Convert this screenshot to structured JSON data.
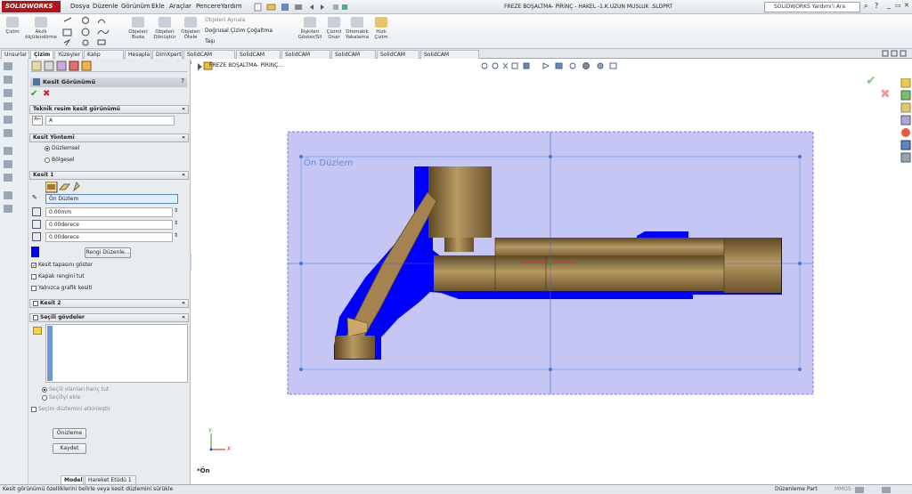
{
  "app": {
    "logo": "SOLIDWORKS",
    "document_title": "FREZE BOŞALTMA- PİRİNÇ - HAKEL -1.K.UZUN MUSLUK .SLDPRT",
    "help_search_placeholder": "SOLIDWORKS Yardımı'i Ara"
  },
  "menu": [
    "Dosya",
    "Düzenle",
    "Görünüm",
    "Ekle",
    "Araçlar",
    "Pencere",
    "Yardım"
  ],
  "ribbon": {
    "buttons": [
      {
        "label": "Çizim"
      },
      {
        "label": "Akıllı ölçülendirme"
      },
      {
        "label": "Objeleri Buda"
      },
      {
        "label": "Objeleri Dönüştür"
      },
      {
        "label": "Objeleri Ötele"
      },
      {
        "label": "İlişkileri Göster/Sil"
      },
      {
        "label": "Çizimi Onar"
      },
      {
        "label": "Otomatik Yakalama"
      },
      {
        "label": "Hızlı Çizim"
      }
    ],
    "mirror_label": "Objeleri Aynala",
    "linear_pattern_label": "Doğrusal Çizim Çoğaltma",
    "move_label": "Taşı"
  },
  "command_tabs": [
    "Unsurlar",
    "Çizim",
    "Yüzeyler",
    "Kalıp Araçları",
    "Hesapla",
    "DimXpert",
    "SolidCAM Parçası",
    "SolidCAM İşler",
    "SolidCAM Parçası",
    "SolidCAM İşler",
    "SolidCAM Part",
    "SolidCAM Operations"
  ],
  "active_tab": "Çizim",
  "feature_tree": {
    "root": "FREZE BOŞALTMA- PİRİNÇ..."
  },
  "property_manager": {
    "title": "Kesit Görünümü",
    "drawing_section_header": "Teknik resim kesit görünümü",
    "drawing_section_value": "A",
    "section_method_header": "Kesit Yöntemi",
    "method_planar": "Düzlemsel",
    "method_zonal": "Bölgesel",
    "section1_header": "Kesit 1",
    "plane_value": "Ön Düzlem",
    "offset_value": "0.00mm",
    "angle1_value": "0.00derece",
    "angle2_value": "0.00derece",
    "edit_color_button": "Rengi Düzenle...",
    "show_cap_label": "Kesit tapasını göster",
    "keep_cap_color_label": "Kapak rengini tut",
    "graphics_only_label": "Yalnızca grafik kesiti",
    "section2_header": "Kesit 2",
    "selected_bodies_header": "Seçili gövdeler",
    "exclude_selected": "Seçili olanları hariç tut",
    "include_selected": "Seçiliyi ekle",
    "enable_plane_label": "Seçim düzlemini etkinleştir",
    "preview_button": "Önizleme",
    "save_button": "Kaydet"
  },
  "viewport": {
    "plane_label": "Ön Düzlem",
    "view_label": "*Ön",
    "triad_x": "X",
    "triad_y": "Y"
  },
  "bottom_tabs": [
    "Model",
    "Hareket Etüdü 1"
  ],
  "status": {
    "message": "Kesit görünümü özelliklerini belirle veya kesit düzlemini sürükle",
    "mode": "Düzenleme Part",
    "units": "MMGS"
  },
  "colors": {
    "section_cap": "#0000ff",
    "plane_fill": "#c5c6f4",
    "plane_border": "#5b66c9",
    "brass": "#a0824c",
    "accept": "#2a9a2a",
    "cancel": "#cc2222"
  }
}
